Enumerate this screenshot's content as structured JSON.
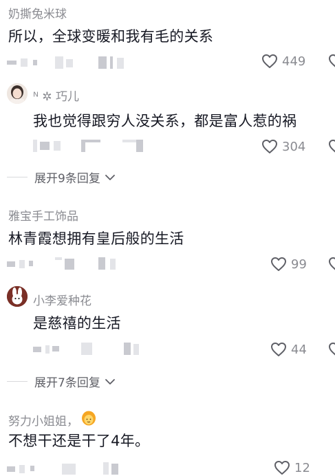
{
  "comments": [
    {
      "username": "奶撕兔米球",
      "content": "所以，全球变暖和我有毛的关系",
      "likes": "449"
    },
    {
      "username": "ᴺ ✲ 巧儿",
      "content": "我也觉得跟穷人没关系，都是富人惹的祸",
      "likes": "304",
      "expand": "展开9条回复"
    },
    {
      "username": "雅宝手工饰品",
      "content": "林青霞想拥有皇后般的生活",
      "likes": "99"
    },
    {
      "username": "小李爱种花",
      "content": "是慈禧的生活",
      "likes": "44",
      "expand": "展开7条回复"
    },
    {
      "username": "努力小姐姐，",
      "content": "不想干还是干了4年。",
      "likes": "12"
    }
  ],
  "icons": {
    "like": "heart-outline-icon",
    "expand": "chevron-down-icon",
    "avatar_qiaoer": "girl-avatar",
    "avatar_xiaoli": "rabbit-avatar",
    "emoji": "woman-emoji"
  },
  "colors": {
    "text": "#161823",
    "secondary": "#8a8b91",
    "expand": "#5e5f66",
    "blur": "#c9cad0"
  }
}
